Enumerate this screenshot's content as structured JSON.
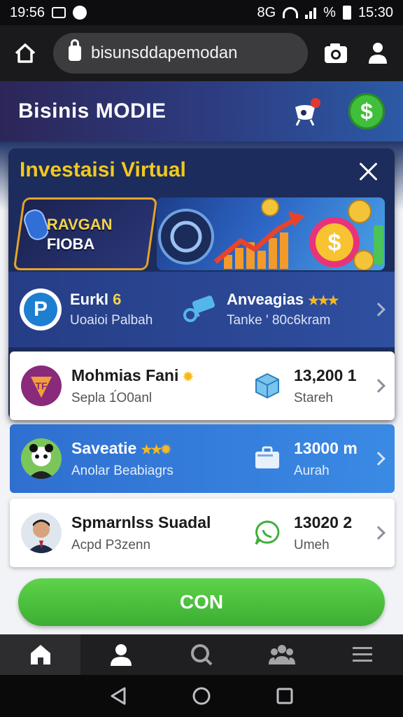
{
  "status_bar": {
    "time_left": "19:56",
    "signal_text": "8G",
    "percent": "%",
    "time_right": "15:30"
  },
  "browser": {
    "url": "bisunsddapemodan"
  },
  "app": {
    "title": "Bisinis MODIE"
  },
  "modal": {
    "title": "Investaisi Virtual",
    "banner": {
      "line1": "RAVGAN",
      "line2": "FIOBA"
    },
    "feature_left": {
      "name": "Eurkl",
      "name_highlight": "6",
      "sub": "Uoaioi Palbah"
    },
    "feature_right": {
      "name": "Anveagias",
      "sub": "Tanke ' 80c6kram"
    }
  },
  "list": [
    {
      "name": "Mohmias Fani",
      "sub": "Sepla 1́O0anl",
      "value": "13,200 1",
      "unit": "Stareh"
    },
    {
      "name": "Saveatie",
      "sub": "Anolar Beabiagrs",
      "value": "13000 m",
      "unit": "Aurah"
    },
    {
      "name": "Spmarnlss Suadal",
      "sub": "Acpd P3zenn",
      "value": "13020 2",
      "unit": "Umeh"
    }
  ],
  "cta": {
    "label": "CON"
  },
  "colors": {
    "accent_green": "#3fbf3a",
    "title_yellow": "#f2c81e",
    "header_blue": "#2d3d82"
  }
}
